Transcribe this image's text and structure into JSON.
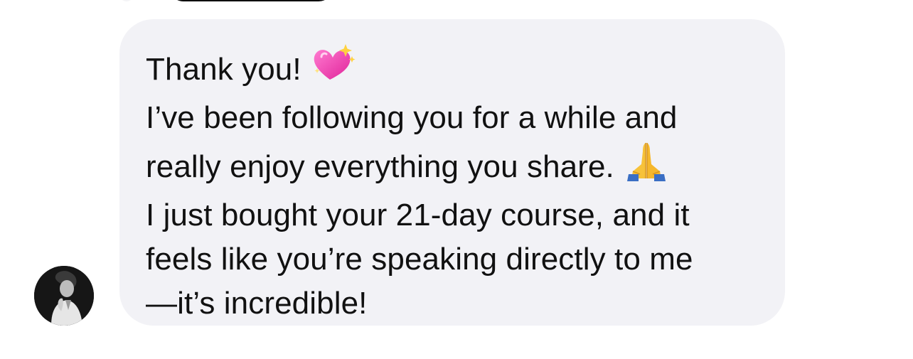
{
  "message": {
    "lines": [
      "Thank you!",
      "I’ve been following you for a while and",
      "really enjoy everything you share.",
      "I just bought your 21-day course, and it",
      "feels like you’re speaking directly to me",
      "—it’s incredible!"
    ],
    "emojis": {
      "line1": "sparkling-heart-icon",
      "line3": "folded-hands-icon"
    }
  },
  "colors": {
    "bubble_background": "#f2f2f6",
    "text": "#111111",
    "page_background": "#ffffff"
  }
}
